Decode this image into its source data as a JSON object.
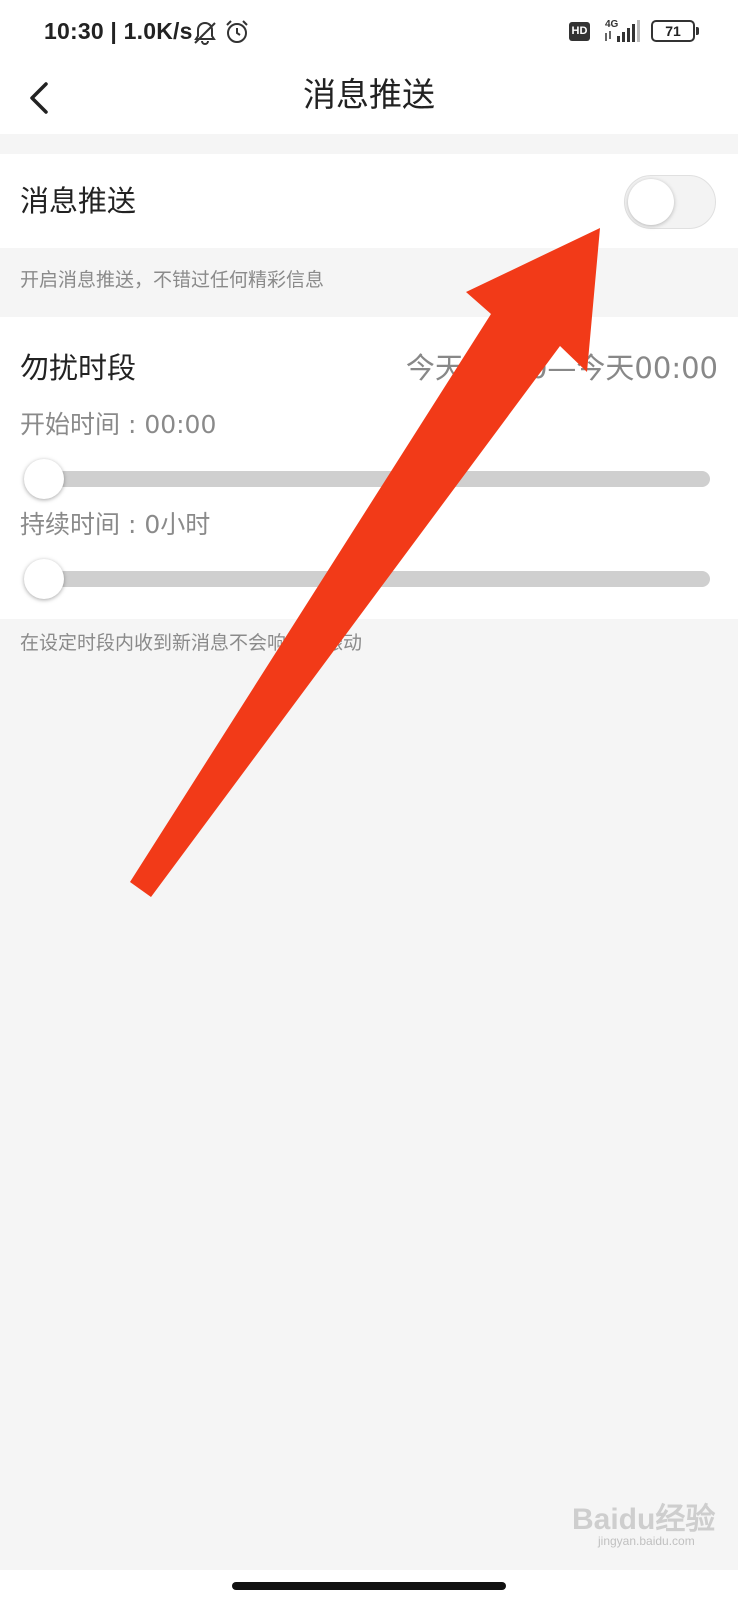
{
  "status_bar": {
    "time": "10:30 | 1.0K/s",
    "hd_label": "HD",
    "network_label": "4G",
    "battery": "71"
  },
  "header": {
    "title": "消息推送",
    "back_icon": "chevron-left-icon"
  },
  "push": {
    "label": "消息推送",
    "enabled": false,
    "hint": "开启消息推送，不错过任何精彩信息"
  },
  "dnd": {
    "label": "勿扰时段",
    "range": "今天00:00—今天00:00",
    "start_label": "开始时间 : 00:00",
    "start_value": 0,
    "duration_label": "持续时间 : 0小时",
    "duration_value": 0,
    "hint": "在设定时段内收到新消息不会响铃或振动"
  },
  "annotation": {
    "arrow_color": "#f23a18"
  },
  "watermark": {
    "text": "Baidu经验",
    "sub": "jingyan.baidu.com"
  },
  "colors": {
    "background": "#f5f5f5",
    "surface": "#ffffff",
    "track": "#cfcfcf",
    "hint": "#8a8a8a"
  }
}
